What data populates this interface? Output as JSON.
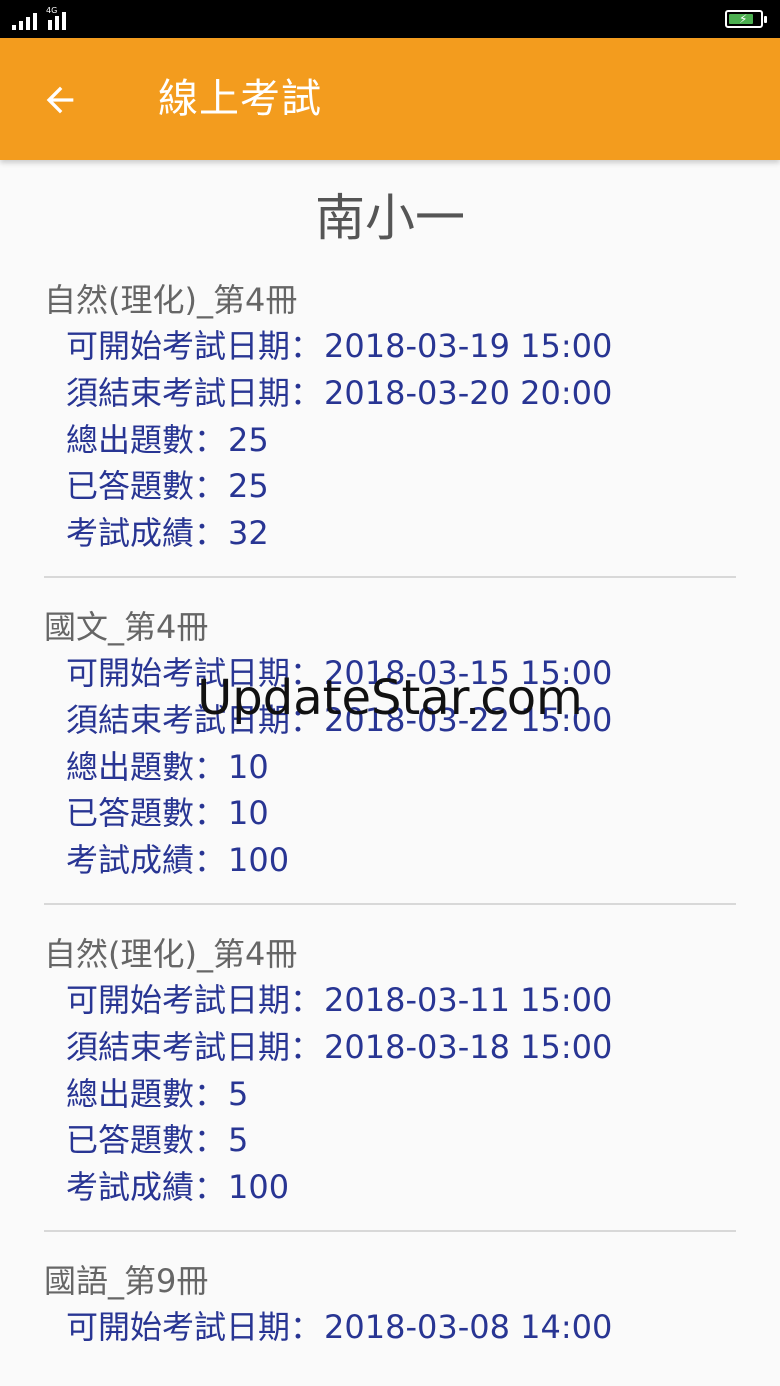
{
  "status_bar": {
    "network_label": "4G",
    "battery_level": 0.8,
    "signal_icon": "signal-bars-icon",
    "battery_icon": "battery-charging-icon"
  },
  "app_bar": {
    "back_icon": "arrow-left-icon",
    "title": "線上考試",
    "background_color": "#f39c1e"
  },
  "school_name": "南小一",
  "records": [
    {
      "subject": "自然(理化)_第4冊",
      "start_label": "可開始考試日期：",
      "start_value": "2018-03-19 15:00",
      "end_label": "須結束考試日期：",
      "end_value": "2018-03-20 20:00",
      "total_label": "總出題數：",
      "total_value": "25",
      "answered_label": "已答題數：",
      "answered_value": "25",
      "score_label": "考試成績：",
      "score_value": "32"
    },
    {
      "subject": "國文_第4冊",
      "start_label": "可開始考試日期：",
      "start_value": "2018-03-15 15:00",
      "end_label": "須結束考試日期：",
      "end_value": "2018-03-22 15:00",
      "total_label": "總出題數：",
      "total_value": "10",
      "answered_label": "已答題數：",
      "answered_value": "10",
      "score_label": "考試成績：",
      "score_value": "100"
    },
    {
      "subject": "自然(理化)_第4冊",
      "start_label": "可開始考試日期：",
      "start_value": "2018-03-11 15:00",
      "end_label": "須結束考試日期：",
      "end_value": "2018-03-18 15:00",
      "total_label": "總出題數：",
      "total_value": "5",
      "answered_label": "已答題數：",
      "answered_value": "5",
      "score_label": "考試成績：",
      "score_value": "100"
    },
    {
      "subject": "國語_第9冊",
      "start_label": "可開始考試日期：",
      "start_value": "2018-03-08 14:00"
    }
  ],
  "watermark": "UpdateStar.com",
  "colors": {
    "label_text": "#283593",
    "subject_text": "#666666",
    "divider": "#d8d8d8"
  }
}
